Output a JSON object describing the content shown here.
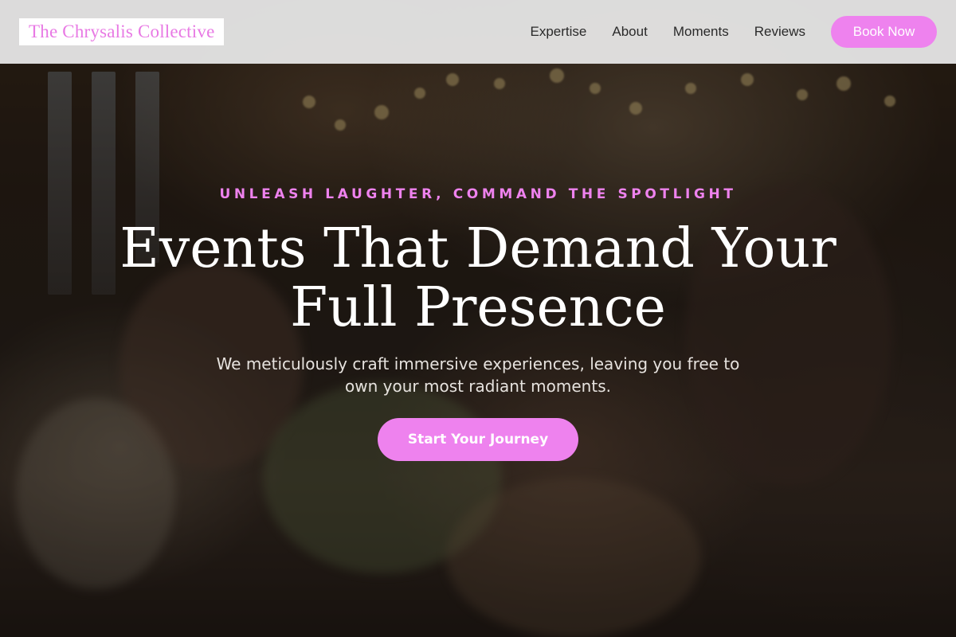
{
  "navbar": {
    "brand": "The Chrysalis Collective",
    "links": [
      {
        "label": "Expertise"
      },
      {
        "label": "About"
      },
      {
        "label": "Moments"
      },
      {
        "label": "Reviews"
      }
    ],
    "cta_label": "Book Now"
  },
  "hero": {
    "eyebrow": "UNLEASH LAUGHTER, COMMAND THE SPOTLIGHT",
    "headline_line1": "Events That Demand Your",
    "headline_line2": "Full Presence",
    "subtitle": "We meticulously craft immersive experiences, leaving you free to own your most radiant moments.",
    "cta_label": "Start Your Journey",
    "background": "celebration-photo"
  },
  "colors": {
    "accent": "#ee82ee",
    "navbar_bg": "#e8e8e8",
    "nav_text": "#2a2a2a",
    "headline_text": "#ffffff"
  }
}
